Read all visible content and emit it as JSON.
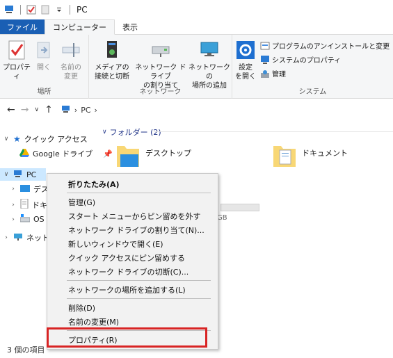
{
  "window": {
    "title": "PC"
  },
  "ribbon_tabs": [
    {
      "label": "ファイル"
    },
    {
      "label": "コンピューター"
    },
    {
      "label": "表示"
    }
  ],
  "ribbon": {
    "location": {
      "label": "場所",
      "properties": "プロパティ",
      "open": "開く",
      "rename_line1": "名前の",
      "rename_line2": "変更"
    },
    "network": {
      "label": "ネットワーク",
      "media_line1": "メディアの",
      "media_line2": "接続と切断",
      "map_drive_line1": "ネットワーク ドライブ",
      "map_drive_line2": "の割り当て",
      "add_location_line1": "ネットワークの",
      "add_location_line2": "場所の追加"
    },
    "system": {
      "label": "システム",
      "settings_line1": "設定",
      "settings_line2": "を開く",
      "uninstall": "プログラムのアンインストールと変更",
      "system_properties": "システムのプロパティ",
      "manage": "管理"
    }
  },
  "address": {
    "crumb": "PC"
  },
  "nav": {
    "quick_access": "クイック アクセス",
    "google_drive": "Google ドライブ",
    "pc": "PC",
    "desktop": "デスク",
    "documents": "ドキュ",
    "os": "OS (",
    "network": "ネットワ"
  },
  "content": {
    "folders_group": "フォルダー (2)",
    "desktop": "デスクトップ",
    "documents": "ドキュメント",
    "storage_suffix": "GB"
  },
  "status": {
    "items": "3 個の項目"
  },
  "context_menu": {
    "collapse": "折りたたみ(A)",
    "manage": "管理(G)",
    "unpin_start": "スタート メニューからピン留めを外す",
    "map_drive": "ネットワーク ドライブの割り当て(N)...",
    "open_new_window": "新しいウィンドウで開く(E)",
    "pin_quick": "クイック アクセスにピン留めする",
    "disconnect_drive": "ネットワーク ドライブの切断(C)...",
    "add_network_location": "ネットワークの場所を追加する(L)",
    "delete": "削除(D)",
    "rename": "名前の変更(M)",
    "properties": "プロパティ(R)"
  },
  "colors": {
    "accent": "#1a5fb4",
    "highlight": "#d82424",
    "selection": "#cce8ff"
  }
}
